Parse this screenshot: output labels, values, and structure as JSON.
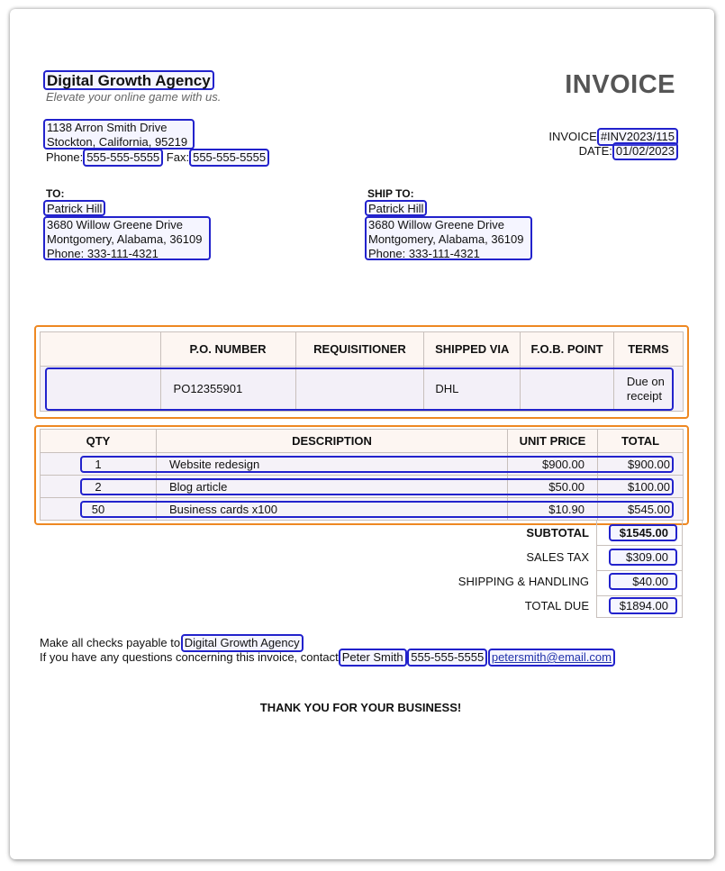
{
  "company": {
    "name": "Digital Growth Agency",
    "tagline": "Elevate your online game with us.",
    "address_line1": "1138 Arron Smith Drive",
    "address_line2": "Stockton, California, 95219",
    "phone_label": "Phone:",
    "phone": "555-555-5555",
    "fax_label": "Fax:",
    "fax": "555-555-5555"
  },
  "invoice": {
    "title": "INVOICE",
    "number_label": "INVOICE",
    "number": "#INV2023/115",
    "date_label": "DATE:",
    "date": "01/02/2023"
  },
  "bill_to": {
    "label": "TO:",
    "name": "Patrick Hill",
    "address_line1": "3680 Willow Greene Drive",
    "address_line2": "Montgomery, Alabama, 36109",
    "phone": "Phone: 333-111-4321"
  },
  "ship_to": {
    "label": "SHIP TO:",
    "name": "Patrick Hill",
    "address_line1": "3680 Willow Greene Drive",
    "address_line2": "Montgomery, Alabama, 36109",
    "phone": "Phone: 333-111-4321"
  },
  "order_info": {
    "headers": [
      "",
      "P.O. NUMBER",
      "REQUISITIONER",
      "SHIPPED VIA",
      "F.O.B. POINT",
      "TERMS"
    ],
    "row": [
      "",
      "PO12355901",
      "",
      "DHL",
      "",
      "Due on receipt"
    ]
  },
  "items": {
    "headers": [
      "QTY",
      "DESCRIPTION",
      "UNIT PRICE",
      "TOTAL"
    ],
    "rows": [
      {
        "qty": "1",
        "description": "Website redesign",
        "unit_price": "$900.00",
        "total": "$900.00"
      },
      {
        "qty": "2",
        "description": "Blog article",
        "unit_price": "$50.00",
        "total": "$100.00"
      },
      {
        "qty": "50",
        "description": "Business cards x100",
        "unit_price": "$10.90",
        "total": "$545.00"
      }
    ]
  },
  "totals": {
    "subtotal_label": "SUBTOTAL",
    "subtotal": "$1545.00",
    "tax_label": "SALES TAX",
    "tax": "$309.00",
    "shipping_label": "SHIPPING & HANDLING",
    "shipping": "$40.00",
    "total_label": "TOTAL DUE",
    "total": "$1894.00"
  },
  "footer": {
    "payable_text": "Make all checks payable to",
    "payable_to": "Digital Growth Agency",
    "questions_text": "If you have any questions concerning this invoice, contact",
    "contact_name": "Peter Smith",
    "contact_phone": "555-555-5555",
    "contact_email": "petersmith@email.com",
    "thanks": "THANK YOU FOR YOUR BUSINESS!"
  },
  "colors": {
    "annotation_box": "#2222cc",
    "group_box": "#ee8822",
    "title_gray": "#555555"
  }
}
